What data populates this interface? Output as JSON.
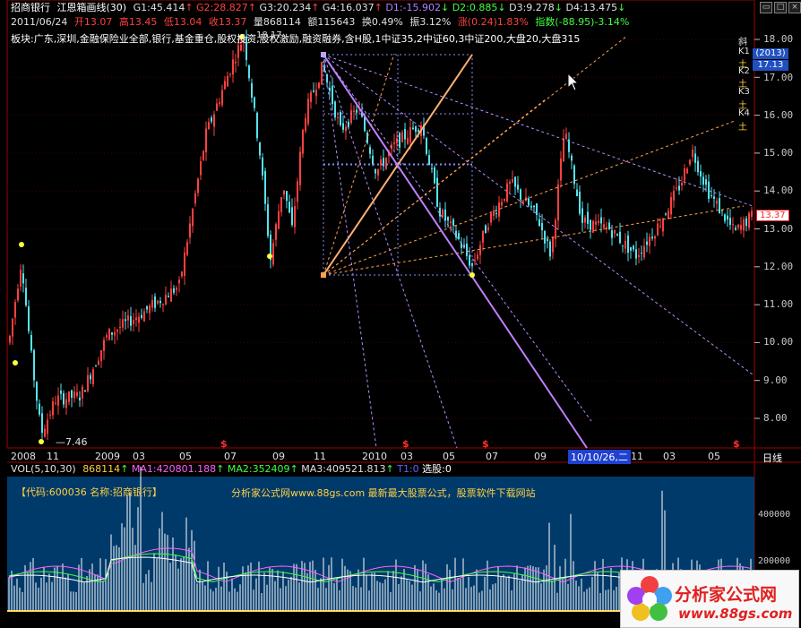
{
  "header": {
    "stock_name": "招商银行",
    "indicator": "江恩箱画线(30)",
    "g1": "G1:45.414",
    "g2": "G2:28.827",
    "g3": "G3:20.234",
    "g4": "G4:16.037",
    "d1": "D1:-15.902",
    "d2": "D2:0.885",
    "d3": "D3:9.278",
    "d4": "D4:13.475",
    "arrows": [
      "↑",
      "↑",
      "↑",
      "↑",
      "↓",
      "↓",
      "↓",
      "↓"
    ]
  },
  "quote": {
    "date": "2011/06/24",
    "open": "开13.07",
    "high": "高13.45",
    "low": "低13.04",
    "close": "收13.37",
    "volume": "量868114",
    "amount": "额115643",
    "turnover": "换0.49%",
    "amplitude": "振3.12%",
    "change": "涨(0.24)1.83%",
    "index": "指数(-88.95)-3.14%"
  },
  "sector": "板块:广东,深圳,金融保险业全部,银行,基金重仓,股权投资,股权激励,融资融券,含H股,1中证35,2中证60,3中证200,大盘20,大盘315",
  "price_axis": [
    "18.00",
    "17.00",
    "16.00",
    "15.00",
    "14.00",
    "13.00",
    "12.00",
    "11.00",
    "10.00",
    "9.00",
    "8.00"
  ],
  "current_price": "13.37",
  "right_panel": {
    "label_top": "斜",
    "rows": [
      "K1",
      "土",
      "K2",
      "土",
      "K3",
      "土",
      "K4",
      "土"
    ],
    "year_badge": "(2013)",
    "price_badge": "17.13"
  },
  "annotations": {
    "low_label": "7.46",
    "high_label": "18.17"
  },
  "time_axis": {
    "labels": [
      "2008",
      "11",
      "2009",
      "03",
      "05",
      "07",
      "09",
      "11",
      "2010",
      "03",
      "05",
      "07",
      "09",
      "11",
      "03",
      "05"
    ],
    "cursor_date": "10/10/26,二",
    "period": "日线"
  },
  "volume": {
    "title": "VOL(5,10,30)",
    "value": "868114",
    "ma1": "MA1:420801.188",
    "ma2": "MA2:352409",
    "ma3": "MA3:409521.813",
    "t1": "T1:0",
    "select": "选股:0",
    "axis": [
      "400000",
      "200000"
    ]
  },
  "banner": {
    "code": "【代码:600036 名称:招商银行】",
    "promo": "分析家公式网www.88gs.com 最新最大股票公式，股票软件下载网站"
  },
  "watermark": {
    "title": "分析家公式网",
    "url": "www.88gs.com"
  },
  "colors": {
    "up": "#ff4040",
    "down": "#54e4f0",
    "gann_main": "#ffb070",
    "gann_diag": "#c080ff",
    "volume_bg": "#003a6a",
    "grid_red": "#800000"
  }
}
